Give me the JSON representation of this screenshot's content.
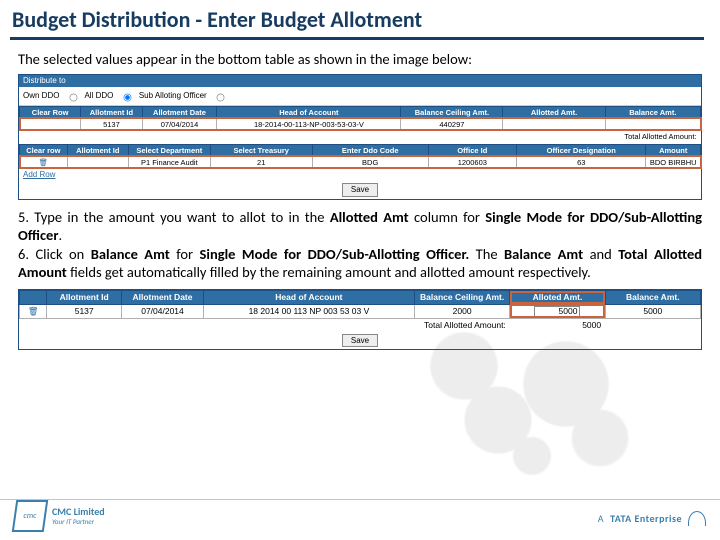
{
  "title": "Budget Distribution - Enter Budget Allotment",
  "lead": "The selected values appear in the bottom table as shown in the image below:",
  "ss1": {
    "dist_label": "Distribute to",
    "opt1": "Own DDO",
    "opt2": "All DDO",
    "opt3": "Sub Alloting Officer",
    "t1h": [
      "Clear Row",
      "Allotment Id",
      "Allotment Date",
      "Head of Account",
      "Balance Ceiling Amt.",
      "Allotted Amt.",
      "Balance Amt."
    ],
    "t1r": [
      "5137",
      "07/04/2014",
      "18-2014-00-113-NP-003-53-03-V",
      "440297"
    ],
    "total_lbl": "Total Allotted Amount:",
    "t2h": [
      "Clear row",
      "Allotment Id",
      "Select Department",
      "Select Treasury",
      "Enter Ddo Code",
      "Office Id",
      "Officer Designation",
      "Amount"
    ],
    "t2r": [
      "P1 Finance Audit",
      "21",
      "BDG",
      "1200603",
      "63",
      "BDO BIRBHU"
    ],
    "addrow": "Add Row",
    "save": "Save"
  },
  "steps": {
    "s5a": "5. Type in the amount you want to allot to in the",
    "s5b": "Allotted Amt",
    "s5c": "column for",
    "s5d": "Single Mode for DDO/Sub-Allotting Officer",
    "s5e": ".",
    "s6a": "6. Click on",
    "s6b": "Balance Amt",
    "s6c": "for",
    "s6d": "Single Mode for DDO/Sub-Allotting Officer.",
    "s6e": "The",
    "s6f": "Balance Amt",
    "s6g": "and",
    "s6h": "Total Allotted Amount",
    "s6i": "fields get automatically filled by the remaining amount and allotted amount respectively."
  },
  "ss2": {
    "th": [
      "Allotment Id",
      "Allotment Date",
      "Head of Account",
      "Balance Ceiling Amt.",
      "Alloted Amt.",
      "Balance Amt."
    ],
    "tr": [
      "5137",
      "07/04/2014",
      "18 2014 00 113 NP 003 53 03 V",
      "2000",
      "5000",
      "5000"
    ],
    "total_lbl": "Total Allotted Amount:",
    "total_val": "5000",
    "save": "Save"
  },
  "footer": {
    "logo_name": "CMC Limited",
    "logo_tag": "Your IT Partner",
    "tata_pre": "A",
    "tata_main": "TATA Enterprise"
  }
}
